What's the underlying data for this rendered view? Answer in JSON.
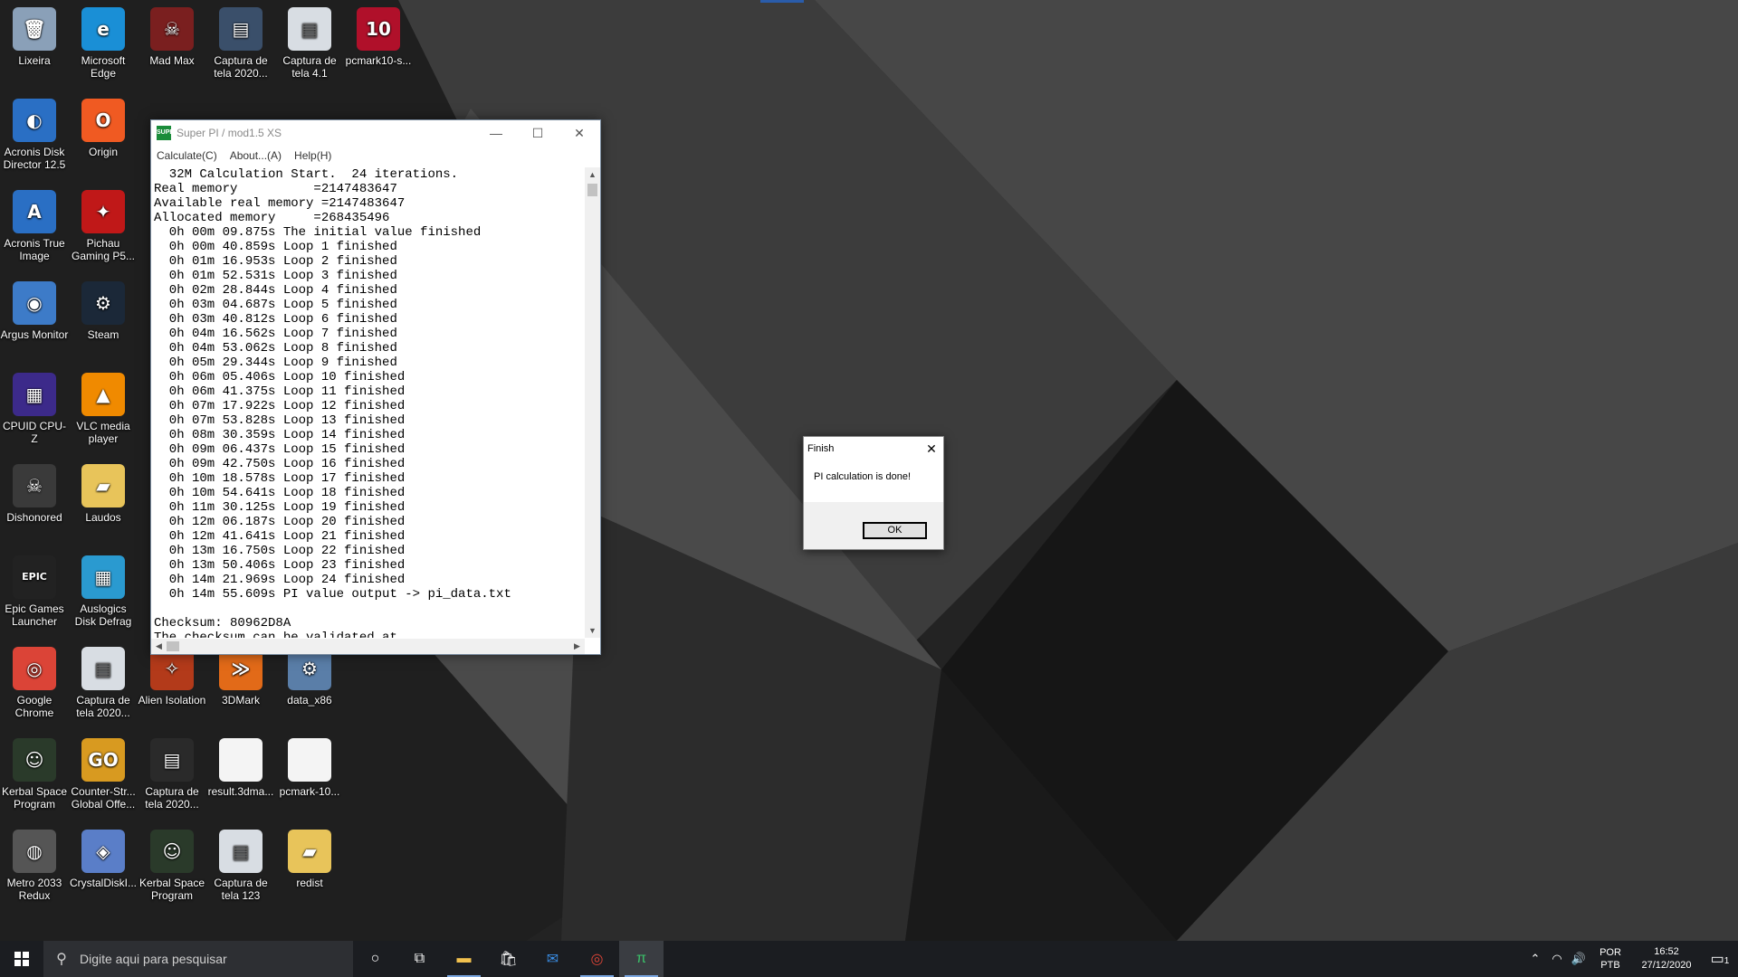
{
  "desktop_icons": [
    {
      "label": "Lixeira",
      "icon": "recycle-bin-icon",
      "color": "#8aa0b8",
      "glyph": "🗑"
    },
    {
      "label": "Microsoft Edge",
      "icon": "edge-icon",
      "color": "#1a8fd6",
      "glyph": "e"
    },
    {
      "label": "Mad Max",
      "icon": "mad-max-icon",
      "color": "#7a1f1f",
      "glyph": "☠"
    },
    {
      "label": "Captura de tela 2020...",
      "icon": "screenshot-file-icon",
      "color": "#3a4f6a",
      "glyph": "▤"
    },
    {
      "label": "Captura de tela 4.1",
      "icon": "screenshot-file-icon",
      "color": "#d8dde3",
      "glyph": "▤"
    },
    {
      "label": "pcmark10-s...",
      "icon": "pcmark10-icon",
      "color": "#b0102a",
      "glyph": "10"
    },
    {
      "label": "Acronis Disk Director 12.5",
      "icon": "acronis-disk-director-icon",
      "color": "#2a6fc4",
      "glyph": "◐"
    },
    {
      "label": "Origin",
      "icon": "origin-icon",
      "color": "#f05a22",
      "glyph": "O"
    },
    {
      "label": "Acronis True Image",
      "icon": "acronis-true-image-icon",
      "color": "#2a6fc4",
      "glyph": "A"
    },
    {
      "label": "Pichau Gaming P5...",
      "icon": "pichau-icon",
      "color": "#c01818",
      "glyph": "✦"
    },
    {
      "label": "Argus Monitor",
      "icon": "argus-monitor-icon",
      "color": "#3d7bc8",
      "glyph": "◉"
    },
    {
      "label": "Steam",
      "icon": "steam-icon",
      "color": "#1b2838",
      "glyph": "⚙"
    },
    {
      "label": "CPUID CPU-Z",
      "icon": "cpuz-icon",
      "color": "#3c2a8a",
      "glyph": "▦"
    },
    {
      "label": "VLC media player",
      "icon": "vlc-icon",
      "color": "#f08a00",
      "glyph": "▲"
    },
    {
      "label": "Dishonored",
      "icon": "dishonored-icon",
      "color": "#3a3a3a",
      "glyph": "☠"
    },
    {
      "label": "Laudos",
      "icon": "folder-icon",
      "color": "#e8c45a",
      "glyph": "▰"
    },
    {
      "label": "Epic Games Launcher",
      "icon": "epic-games-icon",
      "color": "#222222",
      "glyph": "EPIC"
    },
    {
      "label": "Auslogics Disk Defrag",
      "icon": "auslogics-icon",
      "color": "#2a9ad0",
      "glyph": "▦"
    },
    {
      "label": "Google Chrome",
      "icon": "chrome-icon",
      "color": "#db4437",
      "glyph": "◎"
    },
    {
      "label": "Captura de tela 2020...",
      "icon": "screenshot-file-icon",
      "color": "#d8dde3",
      "glyph": "▤"
    },
    {
      "label": "Alien Isolation",
      "icon": "alien-isolation-icon",
      "color": "#b33a1a",
      "glyph": "✧"
    },
    {
      "label": "3DMark",
      "icon": "3dmark-icon",
      "color": "#e26a18",
      "glyph": "≫"
    },
    {
      "label": "data_x86",
      "icon": "data-x86-icon",
      "color": "#5a7ea8",
      "glyph": "⚙"
    },
    {
      "label": "Kerbal Space Program",
      "icon": "kerbal-icon",
      "color": "#2a3a2a",
      "glyph": "☺"
    },
    {
      "label": "Counter-Str... Global Offe...",
      "icon": "csgo-icon",
      "color": "#d89a20",
      "glyph": "GO"
    },
    {
      "label": "Captura de tela 2020...",
      "icon": "screenshot-file-icon",
      "color": "#2a2a2a",
      "glyph": "▤"
    },
    {
      "label": "result.3dma...",
      "icon": "document-icon",
      "color": "#f4f4f4",
      "glyph": ""
    },
    {
      "label": "pcmark-10...",
      "icon": "document-icon",
      "color": "#f4f4f4",
      "glyph": ""
    },
    {
      "label": "Metro 2033 Redux",
      "icon": "metro-2033-icon",
      "color": "#555555",
      "glyph": "◍"
    },
    {
      "label": "CrystalDiskI...",
      "icon": "crystaldiskinfo-icon",
      "color": "#5a7ec8",
      "glyph": "◈"
    },
    {
      "label": "Kerbal Space Program",
      "icon": "kerbal-icon",
      "color": "#2a3a2a",
      "glyph": "☺"
    },
    {
      "label": "Captura de tela 123",
      "icon": "screenshot-file-icon",
      "color": "#d8dde3",
      "glyph": "▤"
    },
    {
      "label": "redist",
      "icon": "folder-icon",
      "color": "#e8c45a",
      "glyph": "▰"
    }
  ],
  "superpi": {
    "title": "Super PI / mod1.5 XS",
    "menu": [
      "Calculate(C)",
      "About...(A)",
      "Help(H)"
    ],
    "log": [
      "  32M Calculation Start.  24 iterations.",
      "Real memory          =2147483647",
      "Available real memory =2147483647",
      "Allocated memory     =268435496",
      "  0h 00m 09.875s The initial value finished",
      "  0h 00m 40.859s Loop 1 finished",
      "  0h 01m 16.953s Loop 2 finished",
      "  0h 01m 52.531s Loop 3 finished",
      "  0h 02m 28.844s Loop 4 finished",
      "  0h 03m 04.687s Loop 5 finished",
      "  0h 03m 40.812s Loop 6 finished",
      "  0h 04m 16.562s Loop 7 finished",
      "  0h 04m 53.062s Loop 8 finished",
      "  0h 05m 29.344s Loop 9 finished",
      "  0h 06m 05.406s Loop 10 finished",
      "  0h 06m 41.375s Loop 11 finished",
      "  0h 07m 17.922s Loop 12 finished",
      "  0h 07m 53.828s Loop 13 finished",
      "  0h 08m 30.359s Loop 14 finished",
      "  0h 09m 06.437s Loop 15 finished",
      "  0h 09m 42.750s Loop 16 finished",
      "  0h 10m 18.578s Loop 17 finished",
      "  0h 10m 54.641s Loop 18 finished",
      "  0h 11m 30.125s Loop 19 finished",
      "  0h 12m 06.187s Loop 20 finished",
      "  0h 12m 41.641s Loop 21 finished",
      "  0h 13m 16.750s Loop 22 finished",
      "  0h 13m 50.406s Loop 23 finished",
      "  0h 14m 21.969s Loop 24 finished",
      "  0h 14m 55.609s PI value output -> pi_data.txt",
      "",
      "Checksum: 80962D8A",
      "The checksum can be validated at"
    ]
  },
  "dialog": {
    "title": "Finish",
    "message": "PI calculation is done!",
    "ok": "OK"
  },
  "taskbar": {
    "search_placeholder": "Digite aqui para pesquisar",
    "language": "POR",
    "layout": "PTB",
    "time": "16:52",
    "date": "27/12/2020",
    "notification_count": "1"
  }
}
